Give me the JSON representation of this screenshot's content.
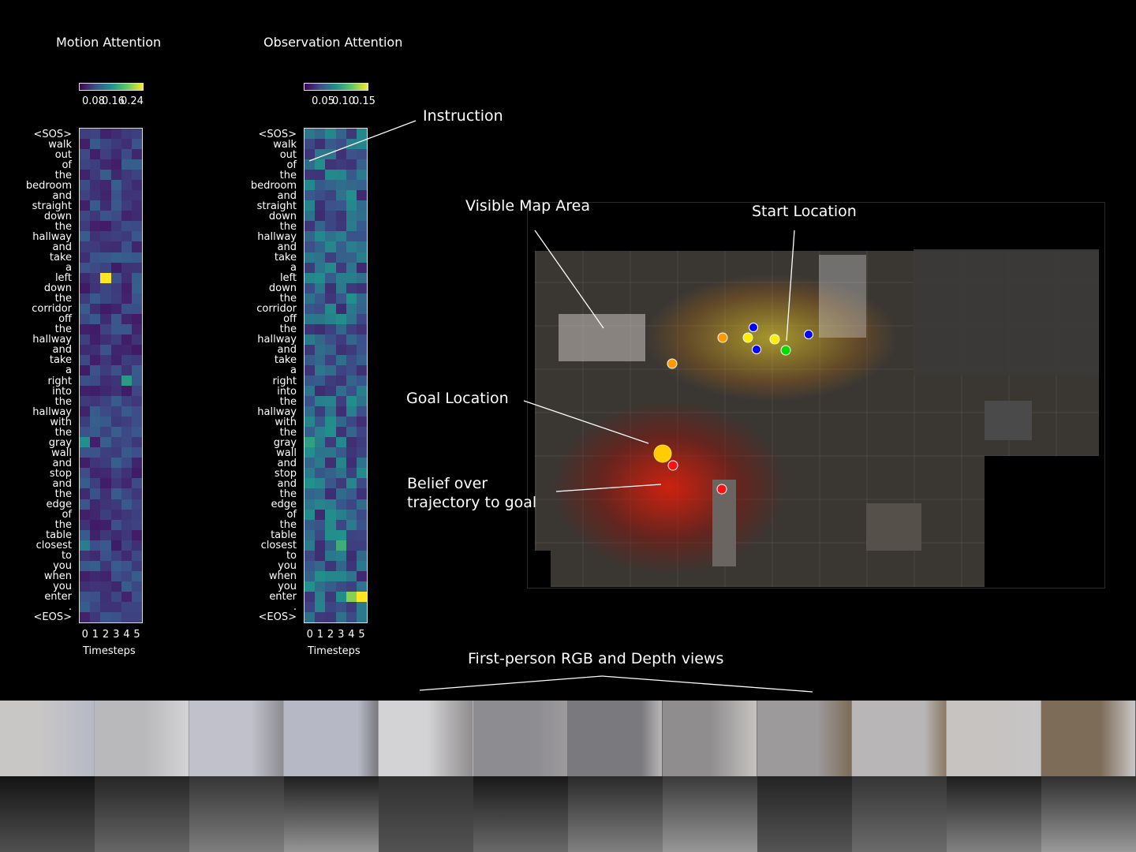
{
  "motion_panel": {
    "title": "Motion Attention",
    "colorbar_ticks": [
      "0.08",
      "0.16",
      "0.24"
    ],
    "xlabel": "Timesteps"
  },
  "observation_panel": {
    "title": "Observation Attention",
    "colorbar_ticks": [
      "0.05",
      "0.10",
      "0.15"
    ],
    "xlabel": "Timesteps"
  },
  "tokens": [
    "<SOS>",
    "walk",
    "out",
    "of",
    "the",
    "bedroom",
    "and",
    "straight",
    "down",
    "the",
    "hallway",
    "and",
    "take",
    "a",
    "left",
    "down",
    "the",
    "corridor",
    "off",
    "the",
    "hallway",
    "and",
    "take",
    "a",
    "right",
    "into",
    "the",
    "hallway",
    "with",
    "the",
    "gray",
    "wall",
    "and",
    "stop",
    "and",
    "the",
    "edge",
    "of",
    "the",
    "table",
    "closest",
    "to",
    "you",
    "when",
    "you",
    "enter",
    ".",
    "<EOS>"
  ],
  "callouts": {
    "instruction": "Instruction",
    "visible_map_area": "Visible Map Area",
    "start_location": "Start Location",
    "goal_location": "Goal Location",
    "belief_line1": "Belief over",
    "belief_line2": "trajectory to goal",
    "first_person": "First-person RGB and Depth views"
  },
  "colors": {
    "viridis_low": "#440154",
    "viridis_high": "#fde725",
    "start_marker": "#00e000",
    "goal_marker": "#ffcc00",
    "waypoint_blue": "#0000ff",
    "waypoint_yellow": "#ffee00",
    "waypoint_orange": "#ff9900",
    "waypoint_red": "#ff1010"
  },
  "chart_data": [
    {
      "type": "heatmap",
      "title": "Motion Attention",
      "xlabel": "Timesteps",
      "x": [
        0,
        1,
        2,
        3,
        4,
        5
      ],
      "colorbar_ticks": [
        0.08,
        0.16,
        0.24
      ],
      "peaks": [
        {
          "token_index": 14,
          "timestep": 2,
          "value": 0.26
        },
        {
          "token_index": 24,
          "timestep": 4,
          "value": 0.14
        },
        {
          "token_index": 30,
          "timestep": 0,
          "value": 0.13
        },
        {
          "token_index": 40,
          "timestep": 0,
          "value": 0.11
        }
      ]
    },
    {
      "type": "heatmap",
      "title": "Observation Attention",
      "xlabel": "Timesteps",
      "x": [
        0,
        1,
        2,
        3,
        4,
        5
      ],
      "colorbar_ticks": [
        0.05,
        0.1,
        0.15
      ],
      "peaks": [
        {
          "token_index": 45,
          "timestep": 5,
          "value": 0.16
        },
        {
          "token_index": 45,
          "timestep": 4,
          "value": 0.13
        },
        {
          "token_index": 40,
          "timestep": 3,
          "value": 0.1
        },
        {
          "token_index": 30,
          "timestep": 0,
          "value": 0.09
        }
      ]
    }
  ]
}
